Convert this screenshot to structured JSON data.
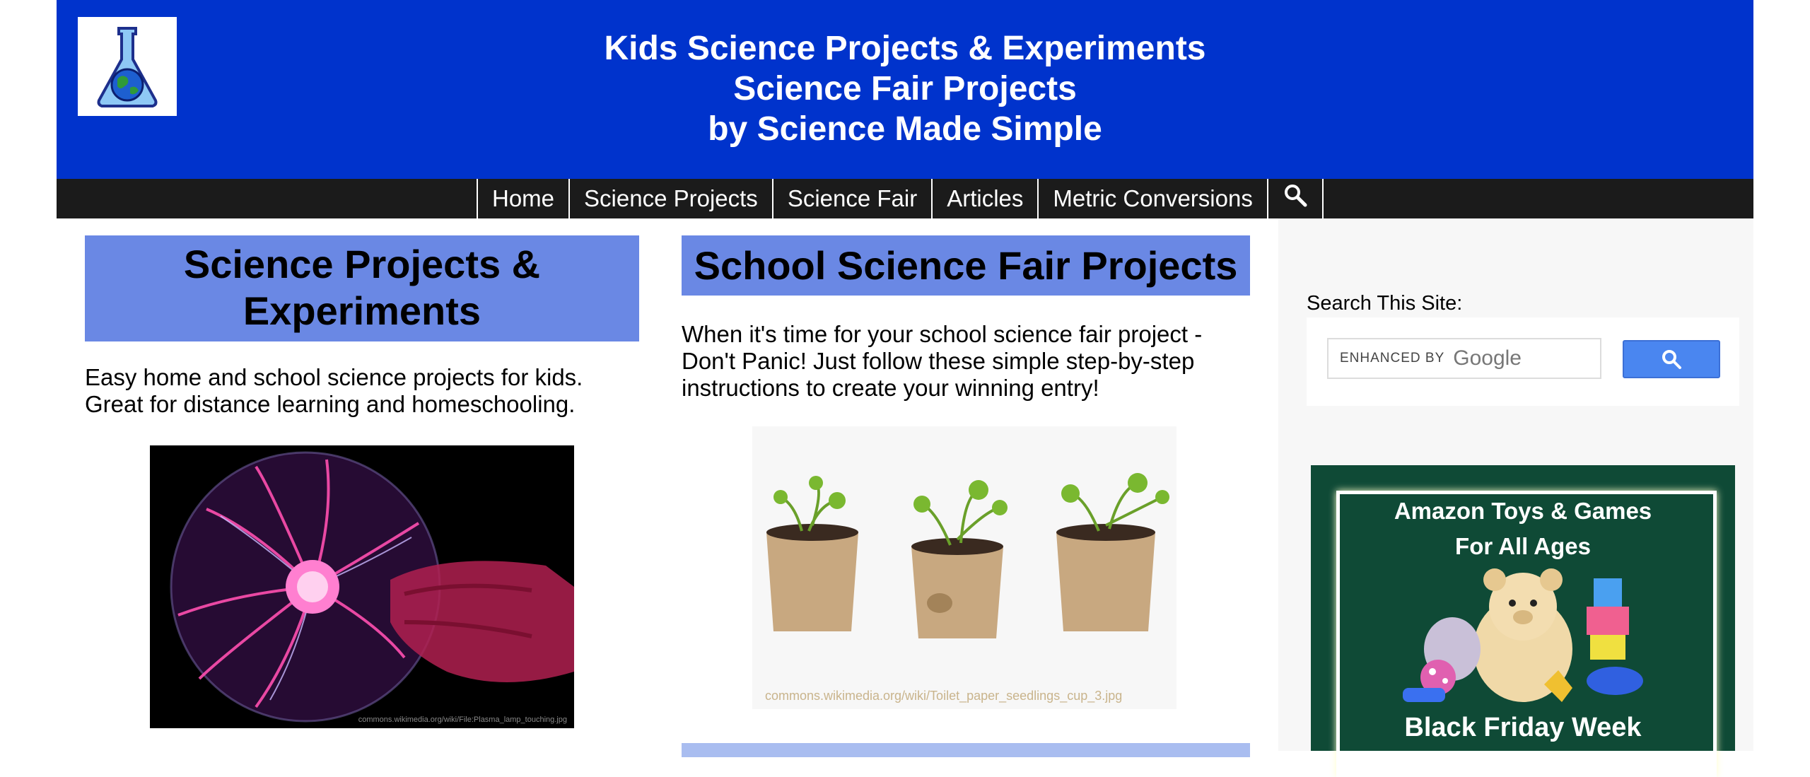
{
  "header": {
    "title_lines": [
      "Kids Science Projects & Experiments",
      "Science Fair Projects",
      "by Science Made Simple"
    ],
    "logo_icon": "flask-globe-icon",
    "background_color": "#0033cc"
  },
  "nav": {
    "items": [
      {
        "label": "Home"
      },
      {
        "label": "Science Projects"
      },
      {
        "label": "Science Fair"
      },
      {
        "label": "Articles"
      },
      {
        "label": "Metric Conversions"
      }
    ],
    "search_icon": "search-icon"
  },
  "left": {
    "heading_lines": [
      "Science Projects &",
      "Experiments"
    ],
    "intro": "Easy home and school science projects for kids. Great for distance learning and homeschooling.",
    "image_caption": "commons.wikimedia.org/wiki/File:Plasma_lamp_touching.jpg"
  },
  "middle": {
    "heading": "School Science Fair Projects",
    "intro": "When it's time for your school science fair project - Don't Panic! Just follow these simple step-by-step instructions to create your winning entry!",
    "image_caption": "commons.wikimedia.org/wiki/Toilet_paper_seedlings_cup_3.jpg"
  },
  "sidebar": {
    "search_label": "Search This Site:",
    "search_enhanced": "ENHANCED BY",
    "search_brand": "Google",
    "ad": {
      "title_lines": [
        "Amazon Toys & Games",
        "For All Ages"
      ],
      "subtitle": "Black Friday Week"
    }
  },
  "colors": {
    "banner": "#6a88e4",
    "nav_bg": "#1b1b1b",
    "ad_bg": "#0f4a36"
  }
}
